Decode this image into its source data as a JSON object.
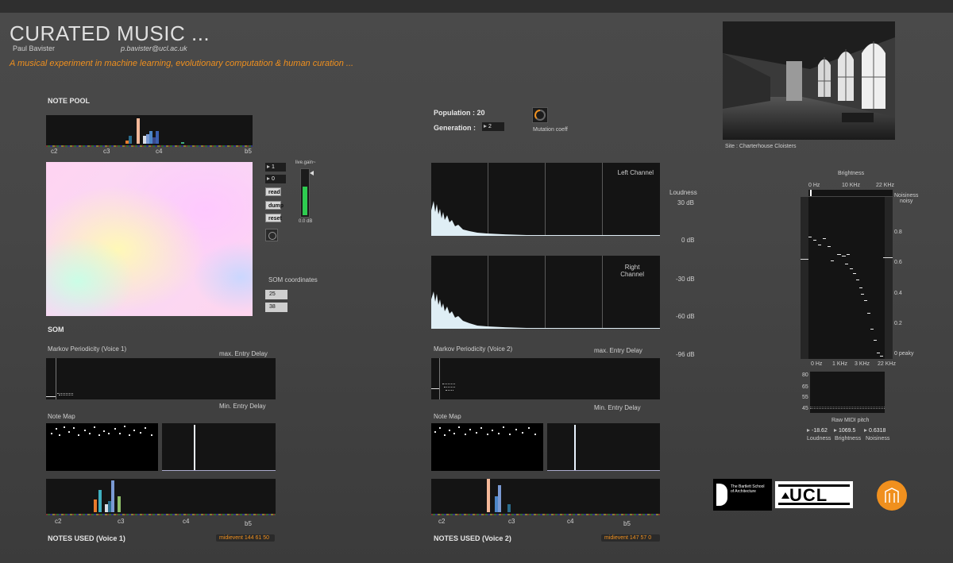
{
  "header": {
    "title": "CURATED MUSIC ...",
    "author": "Paul Bavister",
    "email": "p.bavister@ucl.ac.uk",
    "tagline": "A musical experiment in machine learning, evolutionary computation & human curation ..."
  },
  "note_pool": {
    "label": "NOTE POOL",
    "ticks": [
      "c2",
      "c3",
      "c4",
      "b5"
    ]
  },
  "controls": {
    "num1": "1",
    "num2": "0",
    "read": "read",
    "dump": "dump",
    "reset": "reset",
    "gain_label": "live.gain~",
    "gain_value": "0.0 dB",
    "gain_level": 0.6
  },
  "som": {
    "label": "SOM",
    "coords_label": "SOM coordinates",
    "x": "25",
    "y": "38"
  },
  "evolution": {
    "population": "Population : 20",
    "generation_label": "Generation :",
    "generation_value": "2",
    "mutation_label": "Mutation coeff"
  },
  "spectrum": {
    "left_label": "Left Channel",
    "right_label": "Right\nChannel",
    "loudness_label": "Loudness",
    "db_ticks": [
      "30 dB",
      "0 dB",
      "-30 dB",
      "-60 dB",
      "-96 dB"
    ]
  },
  "site": {
    "caption": "Site : Charterhouse Cloisters"
  },
  "brightness": {
    "title": "Brightness",
    "top_ticks": [
      "0 Hz",
      "10 KHz",
      "22 KHz"
    ],
    "bottom_ticks": [
      "0 Hz",
      "1 KHz",
      "3 KHz",
      "22 KHz"
    ],
    "noisiness_label": "Noisiness\nnoisy",
    "y_ticks": [
      "0.8",
      "0.6",
      "0.4",
      "0.2",
      "0 peaky"
    ],
    "midi_ticks": [
      "80",
      "65",
      "55",
      "45"
    ],
    "raw_midi_label": "Raw MIDI pitch",
    "readouts": [
      {
        "value": "-18.62",
        "label": "Loudness"
      },
      {
        "value": "1069.5",
        "label": "Brightness"
      },
      {
        "value": "0.6318",
        "label": "Noisiness"
      }
    ]
  },
  "voice1": {
    "markov_label": "Markov Periodicity (Voice 1)",
    "max_label": "max. Entry Delay",
    "min_label": "Min. Entry Delay",
    "note_map_label": "Note Map",
    "ticks": [
      "c2",
      "c3",
      "c4",
      "b5"
    ],
    "notes_used_label": "NOTES USED (Voice 1)",
    "midievent": "midievent 144 61 50"
  },
  "voice2": {
    "markov_label": "Markov Periodicity (Voice 2)",
    "max_label": "max. Entry Delay",
    "min_label": "Min. Entry Delay",
    "note_map_label": "Note Map",
    "ticks": [
      "c2",
      "c3",
      "c4",
      "b5"
    ],
    "notes_used_label": "NOTES USED (Voice 2)",
    "midievent": "midievent 147 57 0"
  },
  "logos": {
    "bartlett": "The Bartlett School of Architecture",
    "ucl": "UCL"
  },
  "colors": {
    "accent": "#f0901e",
    "panel": "#141414",
    "meter": "#2ecc50"
  }
}
